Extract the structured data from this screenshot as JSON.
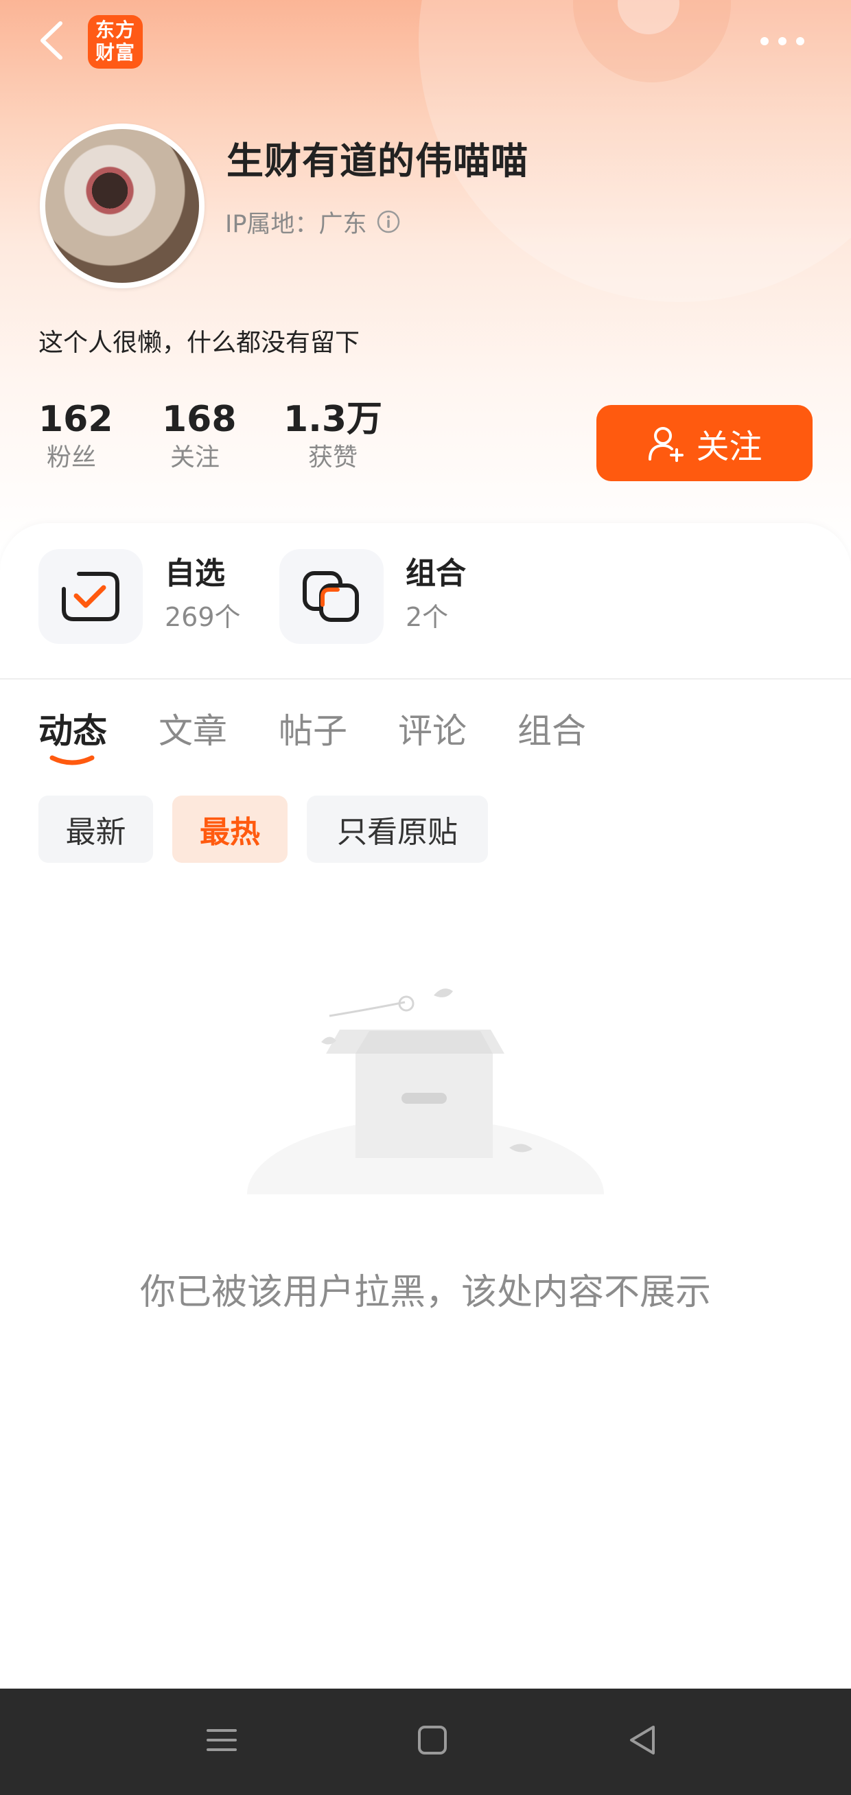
{
  "header": {
    "logo_line1": "东方",
    "logo_line2": "财富",
    "brand_color": "#ff5a16"
  },
  "profile": {
    "username": "生财有道的伟喵喵",
    "ip_label": "IP属地：",
    "ip_value": "广东",
    "bio": "这个人很懒，什么都没有留下"
  },
  "stats": [
    {
      "value": "162",
      "label": "粉丝"
    },
    {
      "value": "168",
      "label": "关注"
    },
    {
      "value": "1.3万",
      "label": "获赞"
    }
  ],
  "follow_button": {
    "label": "关注",
    "color": "#ff5a0f"
  },
  "quick_entries": [
    {
      "title": "自选",
      "count": "269个",
      "icon": "checkbox-icon"
    },
    {
      "title": "组合",
      "count": "2个",
      "icon": "portfolio-icon"
    }
  ],
  "tabs": [
    {
      "label": "动态",
      "active": true
    },
    {
      "label": "文章",
      "active": false
    },
    {
      "label": "帖子",
      "active": false
    },
    {
      "label": "评论",
      "active": false
    },
    {
      "label": "组合",
      "active": false
    }
  ],
  "filters": [
    {
      "label": "最新",
      "active": false
    },
    {
      "label": "最热",
      "active": true
    },
    {
      "label": "只看原贴",
      "active": false
    }
  ],
  "empty_state": {
    "message": "你已被该用户拉黑，该处内容不展示",
    "icon": "empty-box-icon"
  },
  "system_nav": {
    "icons": [
      "menu-icon",
      "home-icon",
      "back-icon"
    ]
  }
}
